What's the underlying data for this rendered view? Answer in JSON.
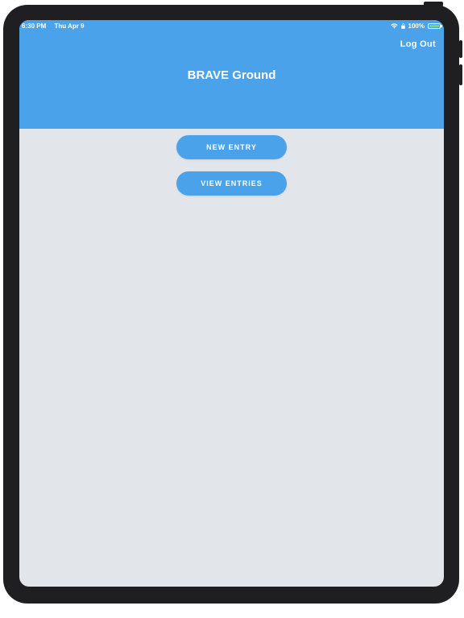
{
  "status_bar": {
    "time": "6:30 PM",
    "date": "Thu Apr 9",
    "battery": "100%"
  },
  "header": {
    "logout_label": "Log Out",
    "title": "BRAVE Ground"
  },
  "actions": {
    "new_entry_label": "NEW ENTRY",
    "view_entries_label": "VIEW ENTRIES"
  },
  "colors": {
    "accent": "#4aa3ea",
    "background": "#e2e5e9",
    "bezel": "#1f1f21",
    "battery_fill": "#7ed957"
  }
}
